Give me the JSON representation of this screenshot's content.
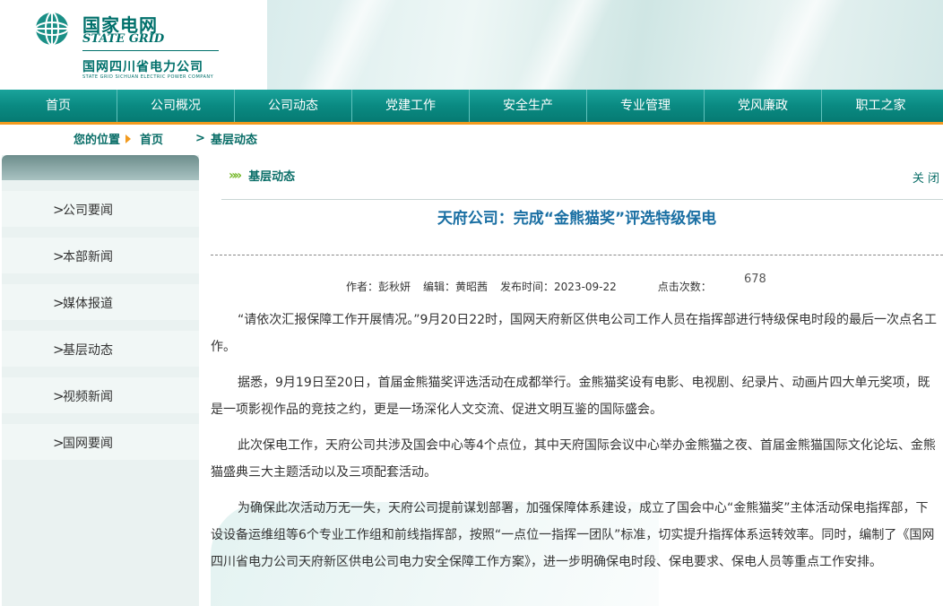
{
  "header": {
    "logo_cn": "国家电网",
    "logo_en": "STATE GRID",
    "company_name": "国网四川省电力公司",
    "company_en": "STATE GRID SICHUAN ELECTRIC POWER COMPANY"
  },
  "nav": [
    "首页",
    "公司概况",
    "公司动态",
    "党建工作",
    "安全生产",
    "专业管理",
    "党风廉政",
    "职工之家"
  ],
  "breadcrumb": {
    "label": "您的位置",
    "home": "首页",
    "current": "基层动态"
  },
  "sidebar": {
    "items": [
      "公司要闻",
      "本部新闻",
      "媒体报道",
      "基层动态",
      "视频新闻",
      "国网要闻"
    ]
  },
  "section": {
    "title": "基层动态",
    "close": "关 闭"
  },
  "article": {
    "title": "天府公司：完成“金熊猫奖”评选特级保电",
    "author": "作者：彭秋妍",
    "editor": "编辑：黄昭茜",
    "date": "发布时间：2023-09-22",
    "clicks_label": "点击次数：",
    "clicks_value": "678",
    "paragraphs": [
      "“请依次汇报保障工作开展情况。”9月20日22时，国网天府新区供电公司工作人员在指挥部进行特级保电时段的最后一次点名工作。",
      "据悉，9月19日至20日，首届金熊猫奖评选活动在成都举行。金熊猫奖设有电影、电视剧、纪录片、动画片四大单元奖项，既是一项影视作品的竞技之约，更是一场深化人文交流、促进文明互鉴的国际盛会。",
      "此次保电工作，天府公司共涉及国会中心等4个点位，其中天府国际会议中心举办金熊猫之夜、首届金熊猫国际文化论坛、金熊猫盛典三大主题活动以及三项配套活动。",
      "为确保此次活动万无一失，天府公司提前谋划部署，加强保障体系建设，成立了国会中心“金熊猫奖”主体活动保电指挥部，下设设备运维组等6个专业工作组和前线指挥部，按照“一点位一指挥一团队”标准，切实提升指挥体系运转效率。同时，编制了《国网四川省电力公司天府新区供电公司电力安全保障工作方案》，进一步明确保电时段、保电要求、保电人员等重点工作安排。"
    ]
  },
  "colors": {
    "brand_green": "#00706b",
    "nav_teal": "#0a8a82",
    "accent_orange": "#f29a1e",
    "title_blue": "#1a6fa3"
  }
}
